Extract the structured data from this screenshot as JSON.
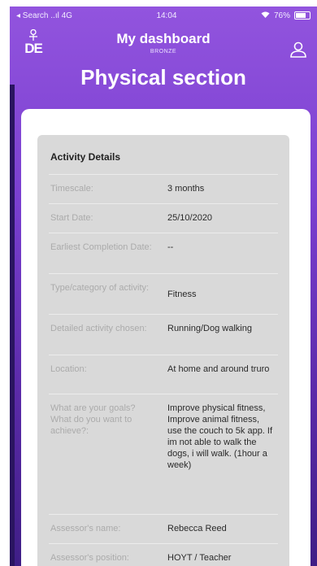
{
  "status_bar": {
    "carrier": "◂ Search ..ıl 4G",
    "time": "14:04",
    "battery": "76%"
  },
  "header": {
    "logo_text": "DE",
    "title": "My dashboard",
    "level": "BRONZE",
    "section": "Physical section"
  },
  "activity": {
    "panel_title": "Activity Details",
    "rows": [
      {
        "label": "Timescale:",
        "value": "3 months"
      },
      {
        "label": "Start Date:",
        "value": "25/10/2020"
      },
      {
        "label": "Earliest Completion Date:",
        "value": "--"
      },
      {
        "label": "Type/category of activity:",
        "value": "Fitness"
      },
      {
        "label": "Detailed activity chosen:",
        "value": "Running/Dog walking"
      },
      {
        "label": "Location:",
        "value": "At home and around truro"
      },
      {
        "label": "What are your goals? What do you want to achieve?:",
        "value": "Improve physical fitness, Improve animal fitness, use the couch to 5k app. If im not able to walk the dogs, i will walk. (1hour a week)"
      },
      {
        "label": "Assessor's name:",
        "value": "Rebecca Reed"
      },
      {
        "label": "Assessor's position:",
        "value": "HOYT / Teacher"
      }
    ]
  }
}
